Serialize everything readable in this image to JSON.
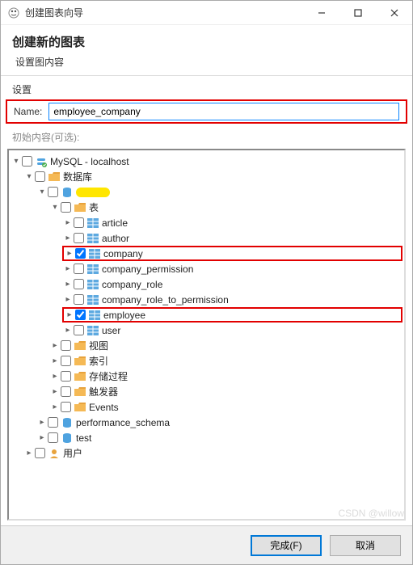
{
  "titlebar": {
    "title": "创建图表向导"
  },
  "header": {
    "title": "创建新的图表",
    "subtitle": "设置图内容"
  },
  "section": {
    "settings": "设置",
    "optional": "初始内容(可选):"
  },
  "name": {
    "label": "Name:",
    "value": "employee_company"
  },
  "tree": {
    "root": "MySQL - localhost",
    "databases": "数据库",
    "tables": "表",
    "table_items": {
      "article": "article",
      "author": "author",
      "company": "company",
      "company_permission": "company_permission",
      "company_role": "company_role",
      "company_role_to_permission": "company_role_to_permission",
      "employee": "employee",
      "user": "user"
    },
    "views": "视图",
    "indexes": "索引",
    "procedures": "存储过程",
    "triggers": "触发器",
    "events": "Events",
    "perf": "performance_schema",
    "test": "test",
    "users": "用户"
  },
  "footer": {
    "finish": "完成(F)",
    "cancel": "取消"
  },
  "watermark": "CSDN @willow"
}
